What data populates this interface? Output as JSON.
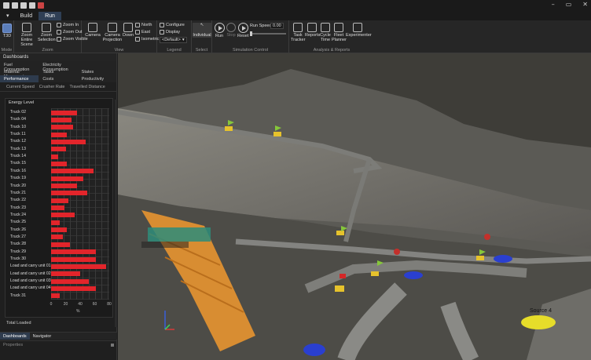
{
  "window": {
    "minimize": "–",
    "restore": "▭",
    "close": "✕"
  },
  "tabs": [
    "Build",
    "Run"
  ],
  "ribbon": {
    "mode": {
      "label": "Mode",
      "button": "T3D"
    },
    "zoom": {
      "label": "Zoom",
      "entire_scene": "Zoom Entire Scene",
      "selection": "Zoom Selection",
      "in": "Zoom In",
      "out": "Zoom Out",
      "visible": "Zoom Visible"
    },
    "view": {
      "label": "View",
      "camera": "Camera",
      "camera_projection": "Camera Projection",
      "down": "Down",
      "north": "North",
      "east": "East",
      "isometric": "Isometric"
    },
    "legend": {
      "label": "Legend",
      "configure": "Configure",
      "display": "Display",
      "default": "<Default>"
    },
    "select": {
      "label": "Select",
      "individual": "Individual"
    },
    "simulation": {
      "label": "Simulation Control",
      "run": "Run",
      "stop": "Stop",
      "reset": "Reset",
      "run_speed": "Run Speed:",
      "speed_value": "0.00"
    },
    "analysis": {
      "label": "Analysis & Reports",
      "task_tracker": "Task Tracker",
      "reports": "Reports",
      "cycle_time": "Cycle Time",
      "fleet_planner": "Fleet Planner",
      "experimenter": "Experimenter"
    }
  },
  "panel": {
    "title": "Dashboards",
    "tabs": [
      "Fuel Consumption",
      "Electricity Consumption",
      "",
      "Material Movement",
      "Tasks",
      "States",
      "Performance",
      "Costs",
      "Productivity"
    ],
    "subtabs": [
      "Current Speed",
      "Crusher Rate",
      "Travelled Distance"
    ],
    "chart_title": "Energy Level",
    "total_loaded": "Total Loaded",
    "bottom_tabs": [
      "Dashboards",
      "Navigator"
    ],
    "properties": "Properties"
  },
  "chart_data": {
    "type": "bar",
    "orientation": "horizontal",
    "title": "Energy Level",
    "xlabel": "%",
    "xlim": [
      0,
      80
    ],
    "xticks": [
      "0",
      "20",
      "40",
      "60",
      "80"
    ],
    "categories": [
      "Truck 02",
      "Truck 04",
      "Truck 10",
      "Truck 11",
      "Truck 12",
      "Truck 13",
      "Truck 14",
      "Truck 15",
      "Truck 16",
      "Truck 19",
      "Truck 20",
      "Truck 21",
      "Truck 22",
      "Truck 23",
      "Truck 24",
      "Truck 25",
      "Truck 26",
      "Truck 27",
      "Truck 28",
      "Truck 29",
      "Truck 30",
      "Load and carry unit 01",
      "Load and carry unit 02",
      "Load and carry unit 03",
      "Load and carry unit 04",
      "Truck 31"
    ],
    "values": [
      36,
      28,
      30,
      22,
      48,
      20,
      10,
      22,
      58,
      44,
      36,
      50,
      24,
      18,
      32,
      12,
      22,
      16,
      26,
      62,
      62,
      76,
      40,
      52,
      62,
      12
    ],
    "color": "#e2252b"
  },
  "scene": {
    "source_label": "Source 4"
  }
}
